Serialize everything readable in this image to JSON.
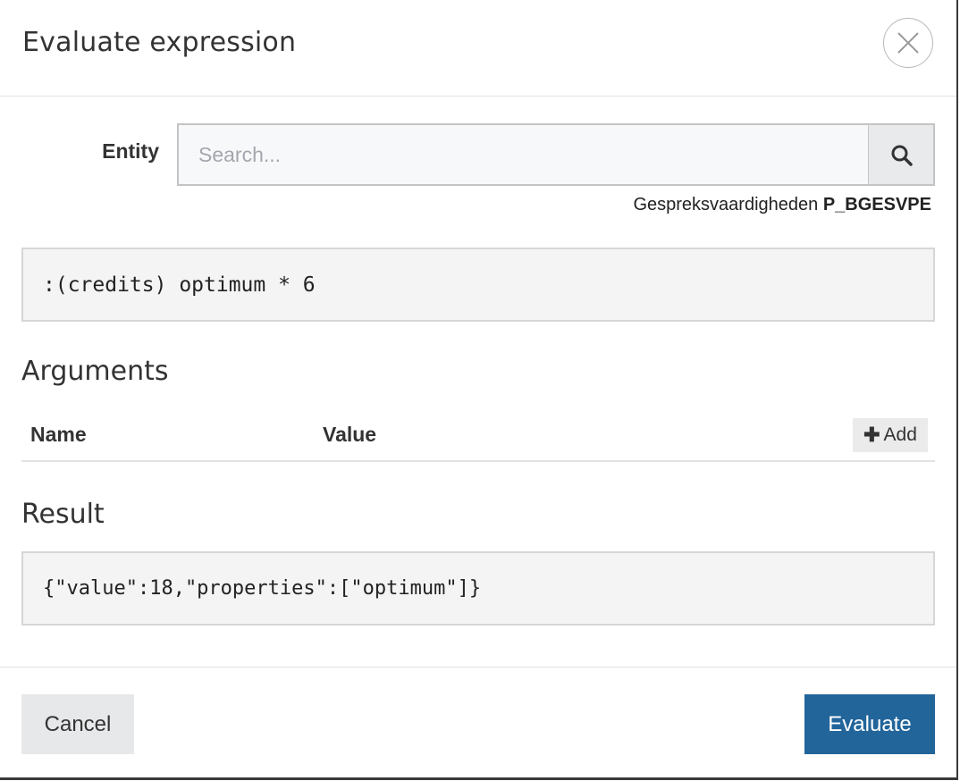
{
  "dialog": {
    "title": "Evaluate expression",
    "close_icon": "close-icon"
  },
  "entity": {
    "label": "Entity",
    "search_placeholder": "Search...",
    "search_value": "",
    "search_icon": "search-icon",
    "selected_name": "Gespreksvaardigheden",
    "selected_code": "P_BGESVPE"
  },
  "expression": {
    "text": ":(credits) optimum * 6"
  },
  "arguments": {
    "title": "Arguments",
    "columns": {
      "name": "Name",
      "value": "Value"
    },
    "rows": [],
    "add_label": "Add",
    "add_icon": "plus-icon"
  },
  "result": {
    "title": "Result",
    "text": "{\"value\":18,\"properties\":[\"optimum\"]}"
  },
  "footer": {
    "cancel_label": "Cancel",
    "evaluate_label": "Evaluate"
  },
  "colors": {
    "primary": "#22659b",
    "secondary_button": "#e7e8ea",
    "code_background": "#f4f4f4"
  }
}
